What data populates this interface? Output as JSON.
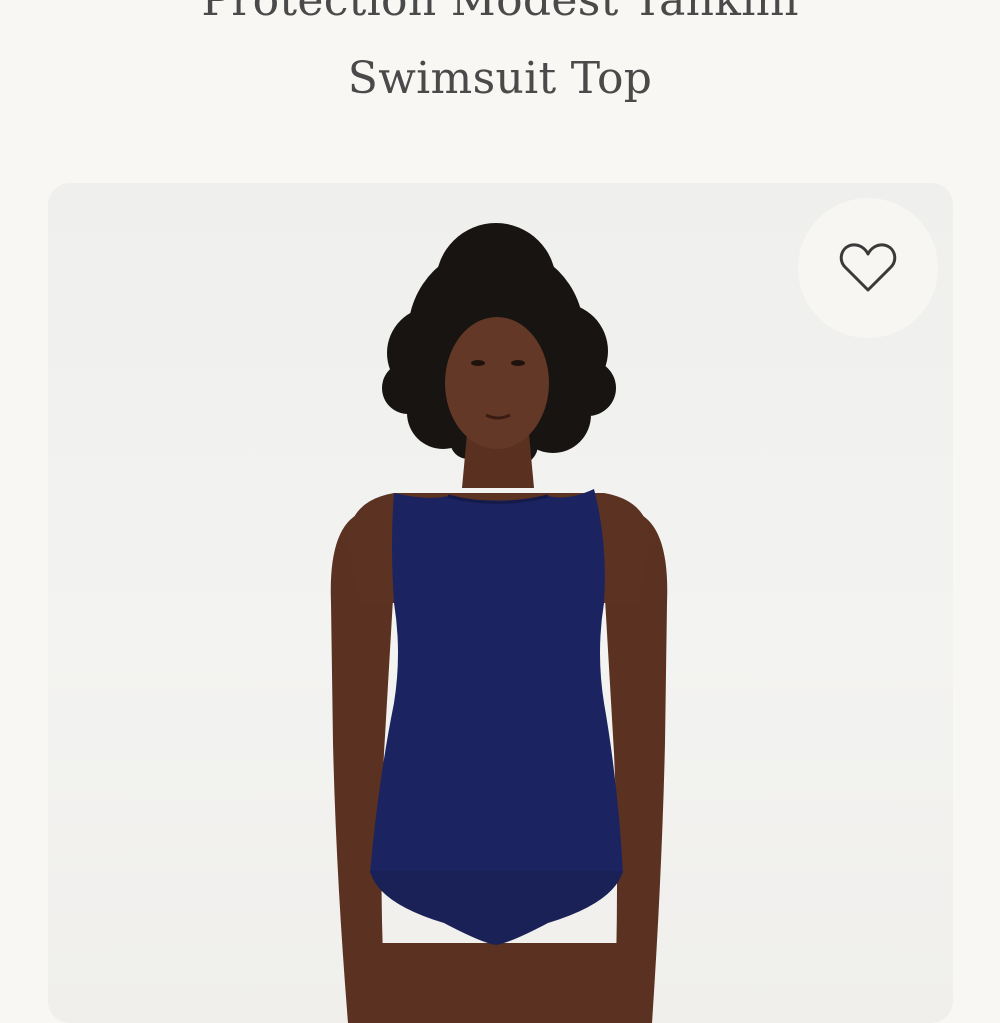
{
  "product": {
    "title_lines": [
      "Protection Modest Tankini",
      "Swimsuit Top"
    ]
  },
  "image": {
    "alt": "Model wearing navy sleeveless high-neck tankini swimsuit top with navy bikini bottom",
    "favorite_icon": "heart-outline-icon"
  },
  "colors": {
    "background": "#f8f7f4",
    "title_text": "#4a4a4a",
    "swimsuit": "#1b2461",
    "skin": "#5e3423",
    "hair": "#171412"
  }
}
